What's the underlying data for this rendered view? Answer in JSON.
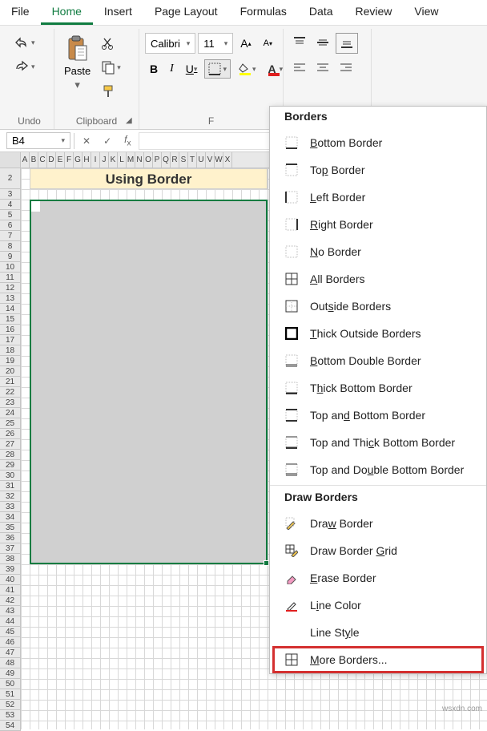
{
  "menubar": {
    "items": [
      "File",
      "Home",
      "Insert",
      "Page Layout",
      "Formulas",
      "Data",
      "Review",
      "View"
    ],
    "active_index": 1
  },
  "ribbon": {
    "undo_label": "Undo",
    "clipboard_label": "Clipboard",
    "paste_label": "Paste",
    "font_name": "Calibri",
    "font_size": "11",
    "font_group_initial": "F"
  },
  "namebox": {
    "value": "B4"
  },
  "sheet": {
    "title_text": "Using Border",
    "columns": [
      "A",
      "B",
      "C",
      "D",
      "E",
      "F",
      "G",
      "H",
      "I",
      "J",
      "K",
      "L",
      "M",
      "N",
      "O",
      "P",
      "Q",
      "R",
      "S",
      "T",
      "U",
      "V",
      "W",
      "X"
    ],
    "rows": [
      2,
      3,
      4,
      5,
      6,
      7,
      8,
      9,
      10,
      11,
      12,
      13,
      14,
      15,
      16,
      17,
      18,
      19,
      20,
      21,
      22,
      23,
      24,
      25,
      26,
      27,
      28,
      29,
      30,
      31,
      32,
      33,
      34,
      35,
      36,
      37,
      38,
      39,
      40,
      41,
      42,
      43,
      44,
      45,
      46,
      47,
      48,
      49,
      50,
      51,
      52,
      53,
      54
    ]
  },
  "dropdown": {
    "sections": [
      {
        "header": "Borders",
        "items": [
          {
            "label_pre": "",
            "u": "B",
            "label_post": "ottom Border",
            "icon": "border-bottom"
          },
          {
            "label_pre": "To",
            "u": "p",
            "label_post": " Border",
            "icon": "border-top"
          },
          {
            "label_pre": "",
            "u": "L",
            "label_post": "eft Border",
            "icon": "border-left"
          },
          {
            "label_pre": "",
            "u": "R",
            "label_post": "ight Border",
            "icon": "border-right"
          },
          {
            "label_pre": "",
            "u": "N",
            "label_post": "o Border",
            "icon": "border-none"
          },
          {
            "label_pre": "",
            "u": "A",
            "label_post": "ll Borders",
            "icon": "border-all"
          },
          {
            "label_pre": "Out",
            "u": "s",
            "label_post": "ide Borders",
            "icon": "border-outside"
          },
          {
            "label_pre": "",
            "u": "T",
            "label_post": "hick Outside Borders",
            "icon": "border-thick-outside"
          },
          {
            "label_pre": "",
            "u": "B",
            "label_post": "ottom Double Border",
            "icon": "border-bottom-double"
          },
          {
            "label_pre": "T",
            "u": "h",
            "label_post": "ick Bottom Border",
            "icon": "border-bottom-thick"
          },
          {
            "label_pre": "Top an",
            "u": "d",
            "label_post": " Bottom Border",
            "icon": "border-top-bottom"
          },
          {
            "label_pre": "Top and Thi",
            "u": "c",
            "label_post": "k Bottom Border",
            "icon": "border-top-thick-bottom"
          },
          {
            "label_pre": "Top and Do",
            "u": "u",
            "label_post": "ble Bottom Border",
            "icon": "border-top-double-bottom"
          }
        ]
      },
      {
        "header": "Draw Borders",
        "items": [
          {
            "label_pre": "Dra",
            "u": "w",
            "label_post": " Border",
            "icon": "draw-border"
          },
          {
            "label_pre": "Draw Border ",
            "u": "G",
            "label_post": "rid",
            "icon": "draw-border-grid"
          },
          {
            "label_pre": "",
            "u": "E",
            "label_post": "rase Border",
            "icon": "erase-border"
          },
          {
            "label_pre": "L",
            "u": "i",
            "label_post": "ne Color",
            "icon": "line-color"
          },
          {
            "label_pre": "Line St",
            "u": "y",
            "label_post": "le",
            "icon": "line-style"
          },
          {
            "label_pre": "",
            "u": "M",
            "label_post": "ore Borders...",
            "icon": "more-borders",
            "highlighted": true
          }
        ]
      }
    ]
  },
  "watermark": "wsxdn.com"
}
